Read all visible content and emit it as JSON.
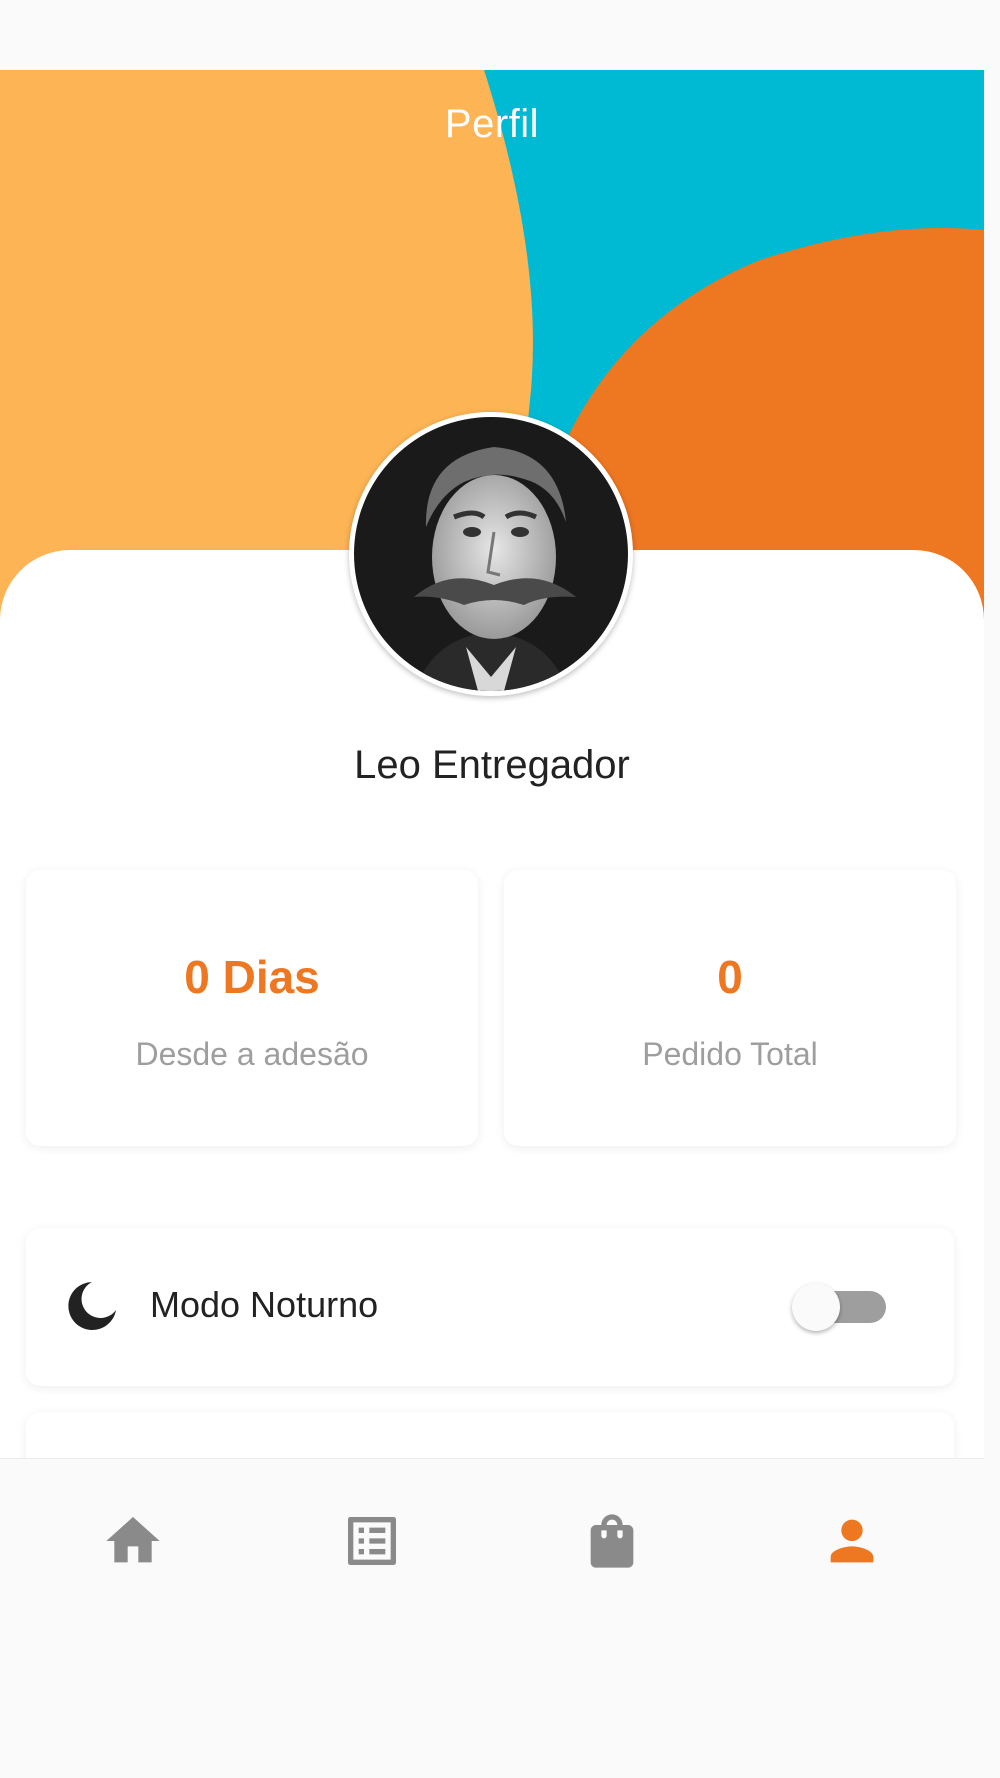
{
  "header": {
    "title": "Perfil"
  },
  "profile": {
    "name": "Leo Entregador"
  },
  "stats": [
    {
      "value": "0 Dias",
      "label": "Desde a adesão"
    },
    {
      "value": "0",
      "label": "Pedido Total"
    }
  ],
  "settings": {
    "dark_mode": {
      "label": "Modo Noturno",
      "icon": "moon-icon",
      "enabled": false
    }
  },
  "bottom_nav": [
    {
      "icon": "home-icon",
      "active": false
    },
    {
      "icon": "orders-list-icon",
      "active": false
    },
    {
      "icon": "shopping-bag-icon",
      "active": false
    },
    {
      "icon": "person-icon",
      "active": true
    }
  ],
  "colors": {
    "accent": "#ee7722",
    "header_orange_light": "#fcb454",
    "header_cyan": "#00bad4",
    "inactive_icon": "#8a8a8a"
  }
}
